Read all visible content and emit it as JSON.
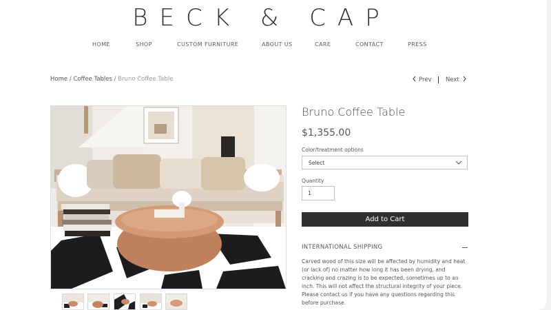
{
  "brand": {
    "logo": "BECK & CAP"
  },
  "nav": {
    "items": [
      "HOME",
      "SHOP",
      "CUSTOM FURNITURE",
      "ABOUT US",
      "CARE",
      "CONTACT",
      "PRESS"
    ]
  },
  "breadcrumb": {
    "home": "Home",
    "category": "Coffee Tables",
    "current": "Bruno Coffee Table",
    "separator": "/"
  },
  "pager": {
    "prev": "Prev",
    "next": "Next"
  },
  "product": {
    "name": "Bruno Coffee Table",
    "price": "$1,355.00",
    "options_label": "Color/treatment options",
    "options_selected": "Select",
    "quantity_label": "Quantity",
    "quantity_value": "1",
    "add_to_cart": "Add to Cart",
    "shipping_title": "INTERNATIONAL SHIPPING",
    "shipping_text": "Carved wood of this size will be affected by humidity and heat (or lack of) no matter how long it has been drying, and cracking and crazing is to be expected, sometimes up to an inch. This will not affect the structural integrity of your piece. Please contact us if you have any questions regarding this before purchase."
  },
  "gallery": {
    "thumbnail_count": 5
  },
  "icons": {
    "prev": "chevron-left-icon",
    "next": "chevron-right-icon",
    "select": "chevron-down-icon",
    "collapse": "minus-icon"
  },
  "colors": {
    "button": "#303030",
    "text": "#555555",
    "border": "#bdbdbd"
  }
}
